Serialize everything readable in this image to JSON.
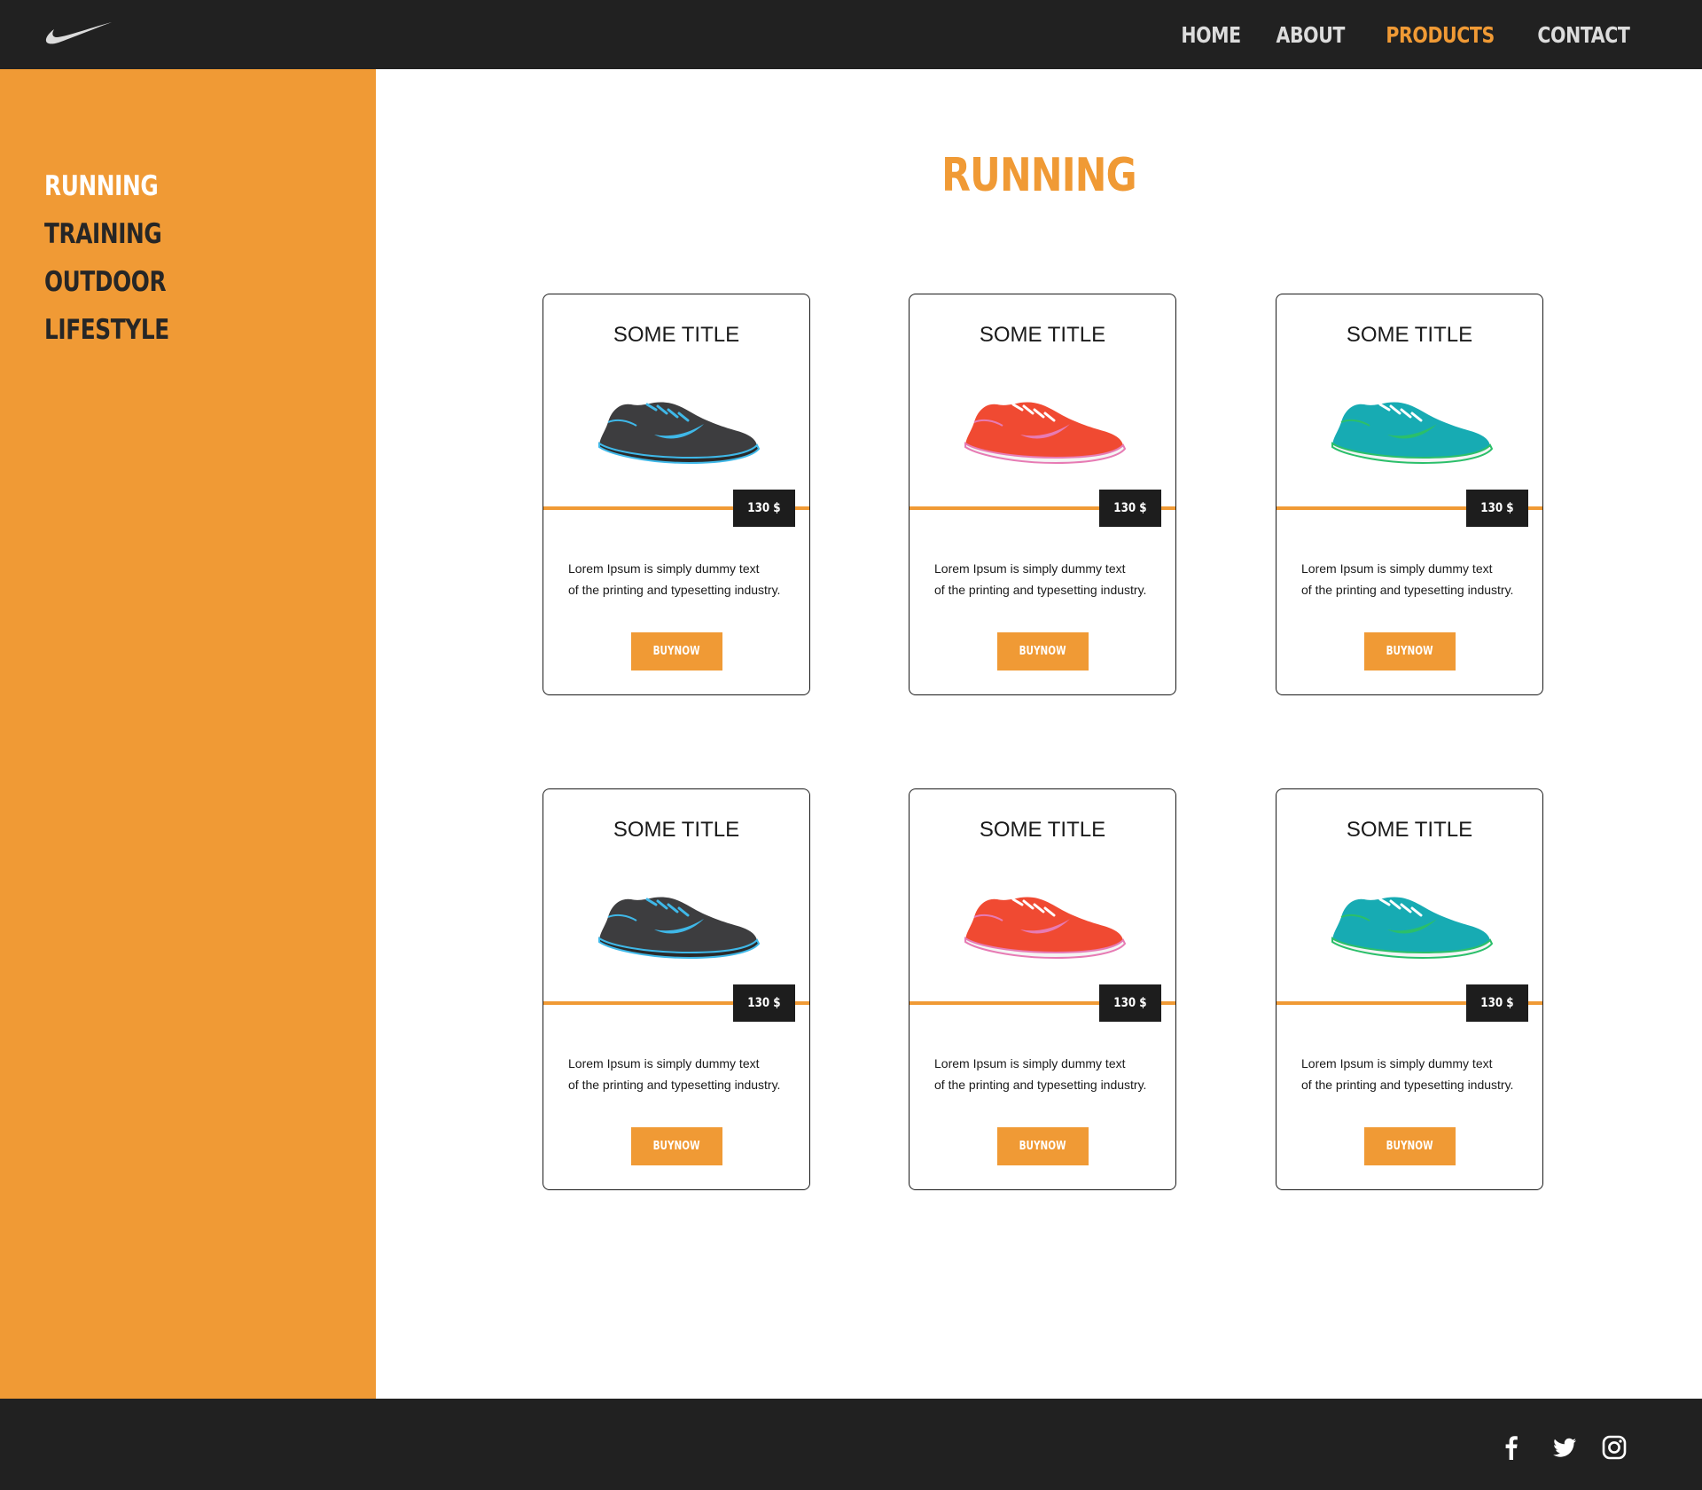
{
  "header": {
    "nav": [
      {
        "label": "HOME",
        "active": false
      },
      {
        "label": "ABOUT",
        "active": false
      },
      {
        "label": "PRODUCTS",
        "active": true
      },
      {
        "label": "CONTACT",
        "active": false
      }
    ]
  },
  "sidebar": {
    "items": [
      {
        "label": "RUNNING",
        "active": true
      },
      {
        "label": "TRAINING",
        "active": false
      },
      {
        "label": "OUTDOOR",
        "active": false
      },
      {
        "label": "LIFESTYLE",
        "active": false
      }
    ]
  },
  "main": {
    "title": "RUNNING",
    "products": [
      {
        "title": "SOME TITLE",
        "price": "130 $",
        "description": "Lorem Ipsum is simply dummy text\nof the printing and typesetting industry.",
        "button": "BUYNOW",
        "shoe": "dark-grey-shoe"
      },
      {
        "title": "SOME TITLE",
        "price": "130 $",
        "description": "Lorem Ipsum is simply dummy text\nof the printing and typesetting industry.",
        "button": "BUYNOW",
        "shoe": "red-shoe"
      },
      {
        "title": "SOME TITLE",
        "price": "130 $",
        "description": "Lorem Ipsum is simply dummy text\nof the printing and typesetting industry.",
        "button": "BUYNOW",
        "shoe": "teal-shoe"
      },
      {
        "title": "SOME TITLE",
        "price": "130 $",
        "description": "Lorem Ipsum is simply dummy text\nof the printing and typesetting industry.",
        "button": "BUYNOW",
        "shoe": "dark-grey-shoe"
      },
      {
        "title": "SOME TITLE",
        "price": "130 $",
        "description": "Lorem Ipsum is simply dummy text\nof the printing and typesetting industry.",
        "button": "BUYNOW",
        "shoe": "red-shoe"
      },
      {
        "title": "SOME TITLE",
        "price": "130 $",
        "description": "Lorem Ipsum is simply dummy text\nof the printing and typesetting industry.",
        "button": "BUYNOW",
        "shoe": "teal-shoe"
      }
    ]
  },
  "footer": {
    "social": [
      "facebook-icon",
      "twitter-icon",
      "instagram-icon"
    ]
  },
  "colors": {
    "accent": "#f09a35",
    "dark": "#212121",
    "shoe_grey": "#3d3d3f",
    "shoe_grey_accent": "#3fb8e8",
    "shoe_red": "#f04a32",
    "shoe_red_accent": "#e77bb4",
    "shoe_teal": "#17abb3",
    "shoe_teal_accent": "#2bbf6a"
  }
}
